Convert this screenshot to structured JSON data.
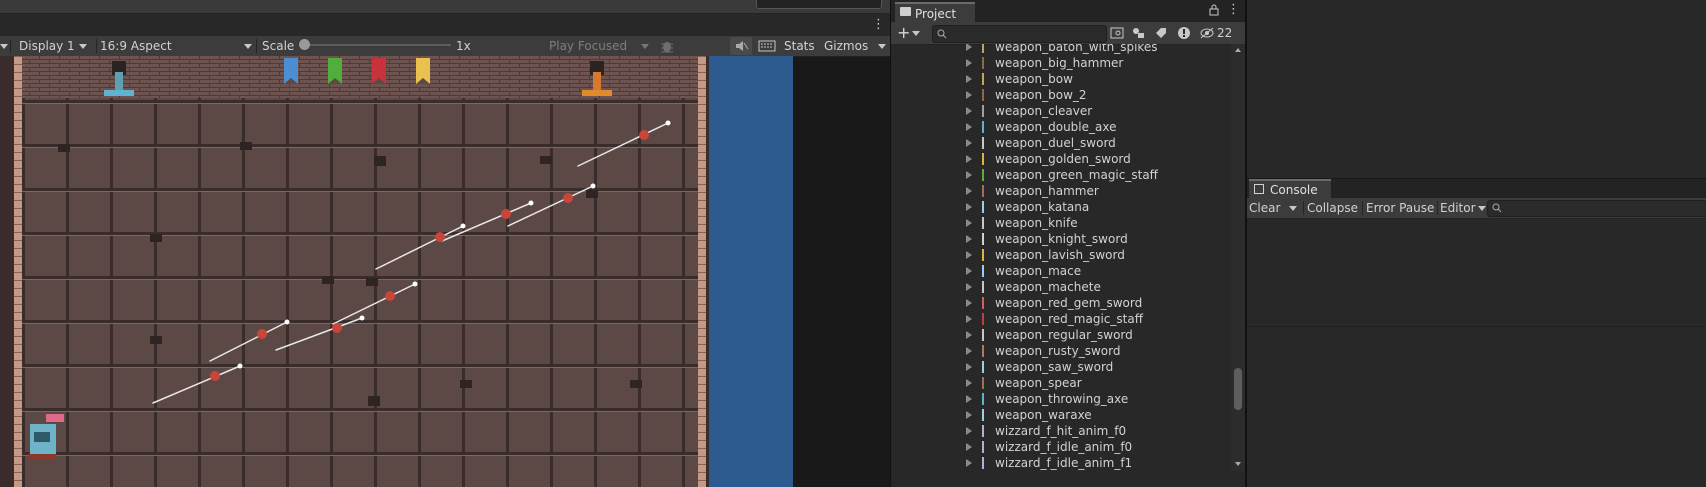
{
  "game_toolbar": {
    "display": "Display 1",
    "aspect": "16:9 Aspect",
    "scale_label": "Scale",
    "scale_value": "1x",
    "play_mode": "Play Focused",
    "stats": "Stats",
    "gizmos": "Gizmos"
  },
  "banner_colors": [
    "#4a8fd6",
    "#4fae3c",
    "#c8323c",
    "#e9c24e"
  ],
  "project": {
    "tab_label": "Project",
    "hidden_count": "22",
    "items": [
      "weapon_baton_with_spikes",
      "weapon_big_hammer",
      "weapon_bow",
      "weapon_bow_2",
      "weapon_cleaver",
      "weapon_double_axe",
      "weapon_duel_sword",
      "weapon_golden_sword",
      "weapon_green_magic_staff",
      "weapon_hammer",
      "weapon_katana",
      "weapon_knife",
      "weapon_knight_sword",
      "weapon_lavish_sword",
      "weapon_mace",
      "weapon_machete",
      "weapon_red_gem_sword",
      "weapon_red_magic_staff",
      "weapon_regular_sword",
      "weapon_rusty_sword",
      "weapon_saw_sword",
      "weapon_spear",
      "weapon_throwing_axe",
      "weapon_waraxe",
      "wizzard_f_hit_anim_f0",
      "wizzard_f_idle_anim_f0",
      "wizzard_f_idle_anim_f1"
    ]
  },
  "console": {
    "tab_label": "Console",
    "clear": "Clear",
    "collapse": "Collapse",
    "error_pause": "Error Pause",
    "editor": "Editor"
  }
}
